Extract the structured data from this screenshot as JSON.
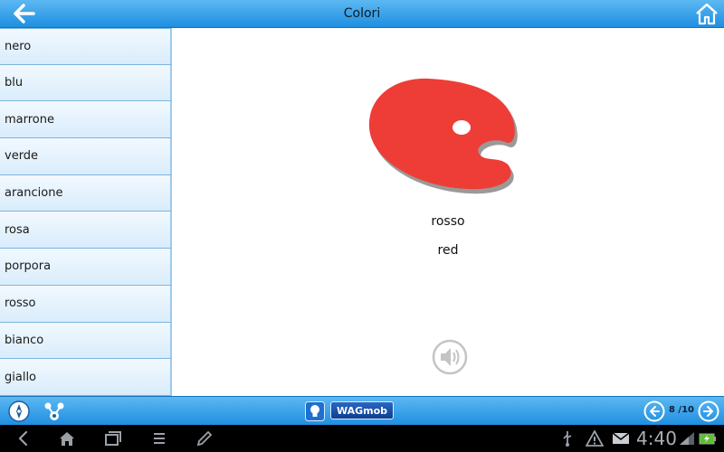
{
  "header": {
    "title": "Colori",
    "back_icon": "back-arrow-icon",
    "home_icon": "home-icon"
  },
  "sidebar": {
    "items": [
      {
        "label": "nero"
      },
      {
        "label": "blu"
      },
      {
        "label": "marrone"
      },
      {
        "label": "verde"
      },
      {
        "label": "arancione"
      },
      {
        "label": "rosa"
      },
      {
        "label": "porpora"
      },
      {
        "label": "rosso"
      },
      {
        "label": "bianco"
      },
      {
        "label": "giallo"
      }
    ]
  },
  "main": {
    "image_icon": "paint-palette-icon",
    "palette_color": "#ee3d37",
    "word_italian": "rosso",
    "word_english": "red",
    "audio_icon": "speaker-icon"
  },
  "bottombar": {
    "brand": "WAGmob",
    "page_count": "8 /10",
    "accent": "#1f8fe0"
  },
  "system": {
    "clock": "4:40"
  }
}
